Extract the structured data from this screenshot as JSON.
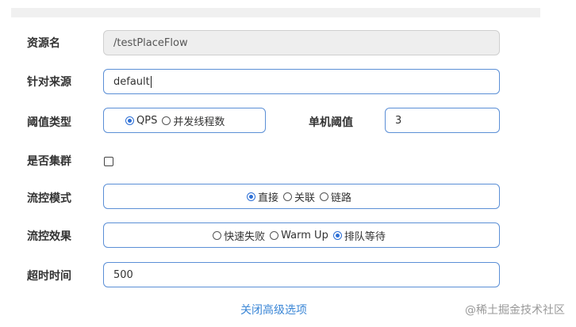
{
  "form": {
    "resource_name": {
      "label": "资源名",
      "value": "/testPlaceFlow"
    },
    "limit_app": {
      "label": "针对来源",
      "value": "default"
    },
    "threshold_type": {
      "label": "阈值类型",
      "options": [
        "QPS",
        "并发线程数"
      ],
      "selected": "QPS"
    },
    "single_threshold": {
      "label": "单机阈值",
      "value": "3"
    },
    "cluster_mode": {
      "label": "是否集群",
      "checked": false
    },
    "flow_strategy": {
      "label": "流控模式",
      "options": [
        "直接",
        "关联",
        "链路"
      ],
      "selected": "直接"
    },
    "control_behavior": {
      "label": "流控效果",
      "options": [
        "快速失败",
        "Warm Up",
        "排队等待"
      ],
      "selected": "排队等待"
    },
    "timeout": {
      "label": "超时时间",
      "value": "500"
    }
  },
  "links": {
    "close_advanced": "关闭高级选项"
  },
  "watermark": "@稀土掘金技术社区",
  "colors": {
    "accent": "#2d6fd6",
    "border": "#5b8fd6",
    "link": "#3a86d6"
  }
}
